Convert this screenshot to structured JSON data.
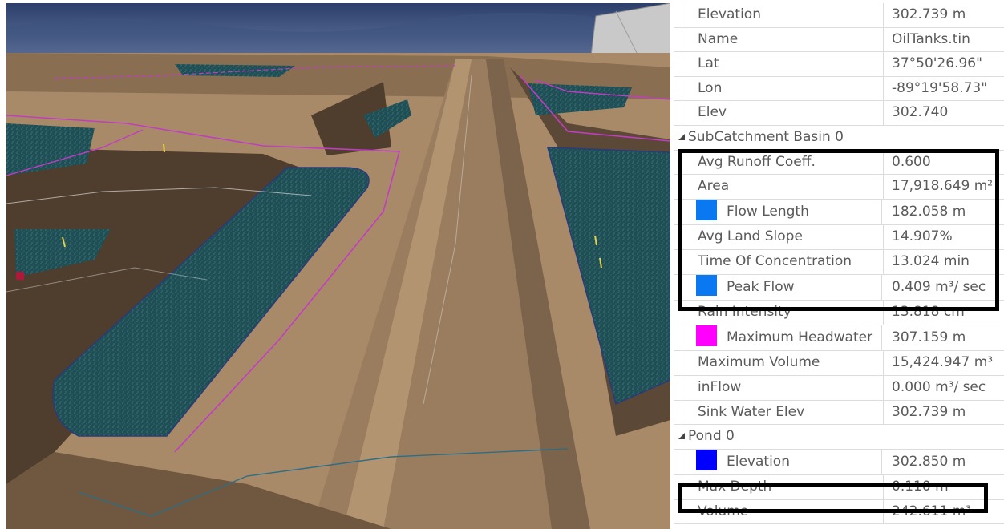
{
  "viewport": {
    "label": "3D terrain view",
    "colors": {
      "sky_top": "#2c3f6a",
      "sky_bottom": "#8a99b7",
      "terrain": "#a98a68",
      "terrain_dark": "#4f3d2d",
      "water": "#1f4e55",
      "boundary": "#c23cc4"
    }
  },
  "properties": {
    "top_rows": [
      {
        "key": "Elevation",
        "value": "302.739 m"
      },
      {
        "key": "Name",
        "value": "OilTanks.tin"
      },
      {
        "key": "Lat",
        "value": "37°50'26.96\""
      },
      {
        "key": "Lon",
        "value": "-89°19'58.73\""
      },
      {
        "key": "Elev",
        "value": "302.740"
      }
    ],
    "subcatchment": {
      "title": "SubCatchment Basin 0",
      "rows": [
        {
          "key": "Avg Runoff Coeff.",
          "value": "0.600"
        },
        {
          "key": "Area",
          "value": "17,918.649 m²"
        },
        {
          "key": "Flow Length",
          "value": "182.058 m",
          "swatch": "#0a78f0"
        },
        {
          "key": "Avg Land Slope",
          "value": "14.907%"
        },
        {
          "key": "Time Of Concentration",
          "value": "13.024 min"
        },
        {
          "key": "Peak Flow",
          "value": "0.409 m³/ sec",
          "swatch": "#0a78f0"
        },
        {
          "key": "Rain Intensity",
          "value": "13.818 cm"
        },
        {
          "key": "Maximum Headwater",
          "value": "307.159 m",
          "swatch": "#ff00ff"
        },
        {
          "key": "Maximum Volume",
          "value": "15,424.947 m³"
        },
        {
          "key": "inFlow",
          "value": "0.000 m³/ sec"
        },
        {
          "key": "Sink Water Elev",
          "value": "302.739 m"
        }
      ]
    },
    "pond": {
      "title": "Pond 0",
      "rows": [
        {
          "key": "Elevation",
          "value": "302.850 m",
          "swatch": "#0000ff"
        },
        {
          "key": "Max Depth",
          "value": "0.110 m"
        },
        {
          "key": "Volume",
          "value": "242.611 m³"
        }
      ]
    }
  }
}
